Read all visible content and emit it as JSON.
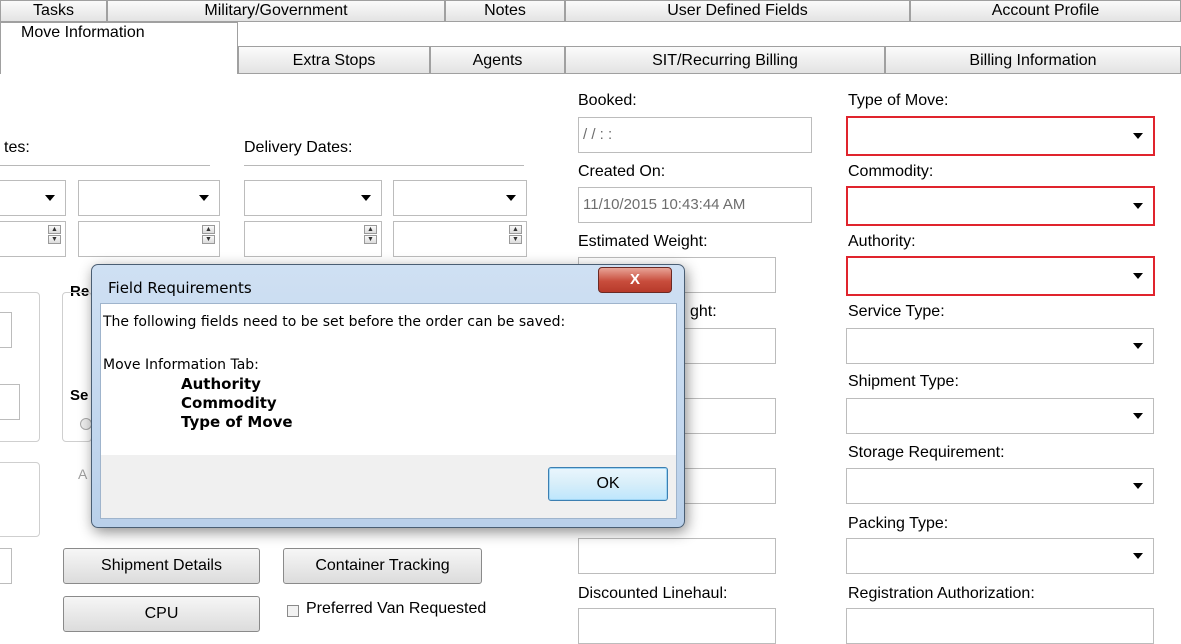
{
  "tabs_row1": [
    "Tasks",
    "Military/Government",
    "Notes",
    "User Defined Fields",
    "Account Profile"
  ],
  "tabs_row2": [
    "Move Information",
    "Extra Stops",
    "Agents",
    "SIT/Recurring Billing",
    "Billing Information"
  ],
  "left": {
    "dates_label_partial": "tes:",
    "delivery_dates_label": "Delivery Dates:",
    "group_r_partial": "Re",
    "group_s_partial": "Se",
    "group_a_partial": "A",
    "shipment_details_button": "Shipment Details",
    "container_tracking_button": "Container Tracking",
    "cpu_button": "CPU",
    "preferred_van_label": "Preferred Van Requested"
  },
  "middle": {
    "booked_label": "Booked:",
    "booked_value": "/ /      : :",
    "created_on_label": "Created On:",
    "created_on_value": "11/10/2015 10:43:44 AM",
    "estimated_weight_label": "Estimated Weight:",
    "weight_label_partial": "ght:",
    "discounted_linehaul_label": "Discounted Linehaul:"
  },
  "right": {
    "type_of_move_label": "Type of Move:",
    "commodity_label": "Commodity:",
    "authority_label": "Authority:",
    "service_type_label": "Service Type:",
    "shipment_type_label": "Shipment Type:",
    "storage_requirement_label": "Storage Requirement:",
    "packing_type_label": "Packing Type:",
    "registration_authorization_label": "Registration Authorization:"
  },
  "dialog": {
    "title": "Field Requirements",
    "close_glyph": "X",
    "message": "The following fields need to be set before the order can be saved:",
    "section": "Move Information Tab:",
    "fields": [
      "Authority",
      "Commodity",
      "Type of Move"
    ],
    "ok_label": "OK"
  },
  "colors": {
    "required_border": "#e0242d",
    "dialog_frame": "#b9d0ea",
    "close_button": "#c84d3c"
  }
}
